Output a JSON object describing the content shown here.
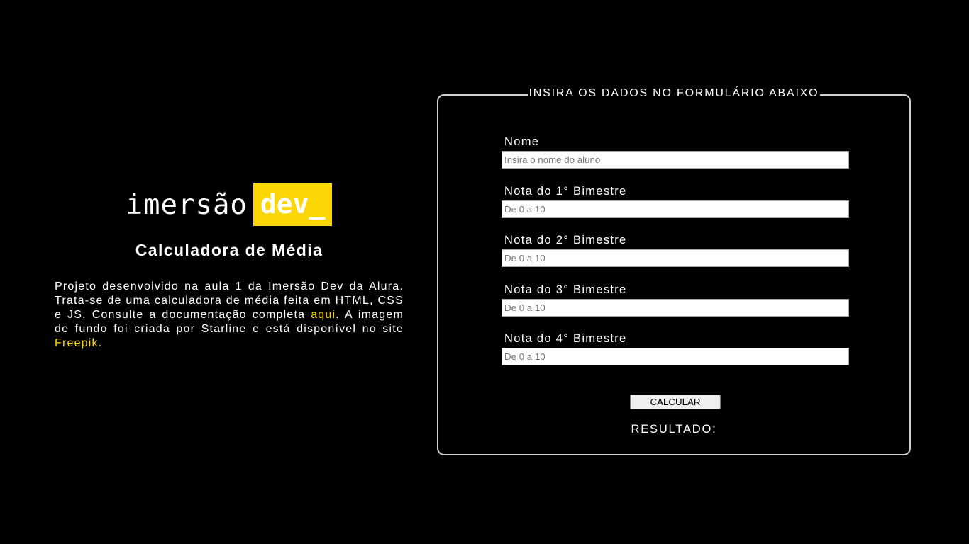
{
  "brand": {
    "logo_word": "imersão",
    "logo_highlight": "dev_",
    "accent_color": "#fcd605"
  },
  "app": {
    "title": "Calculadora de Média",
    "description": {
      "part1": "Projeto desenvolvido na aula 1 da Imersão Dev da Alura. Trata-se de uma calculadora de média feita em HTML, CSS e JS. Consulte a documentação completa ",
      "link1": "aqui",
      "part2": ". A imagem de fundo foi criada por Starline e está disponível no site ",
      "link2": "Freepik",
      "part3": "."
    }
  },
  "form": {
    "legend": "INSIRA OS DADOS NO FORMULÁRIO ABAIXO",
    "fields": [
      {
        "label": "Nome",
        "placeholder": "Insira o nome do aluno",
        "value": ""
      },
      {
        "label": "Nota do 1° Bimestre",
        "placeholder": "De 0 a 10",
        "value": ""
      },
      {
        "label": "Nota do 2° Bimestre",
        "placeholder": "De 0 a 10",
        "value": ""
      },
      {
        "label": "Nota do 3° Bimestre",
        "placeholder": "De 0 a 10",
        "value": ""
      },
      {
        "label": "Nota do 4° Bimestre",
        "placeholder": "De 0 a 10",
        "value": ""
      }
    ],
    "button_label": "CALCULAR",
    "result_label": "RESULTADO:"
  }
}
